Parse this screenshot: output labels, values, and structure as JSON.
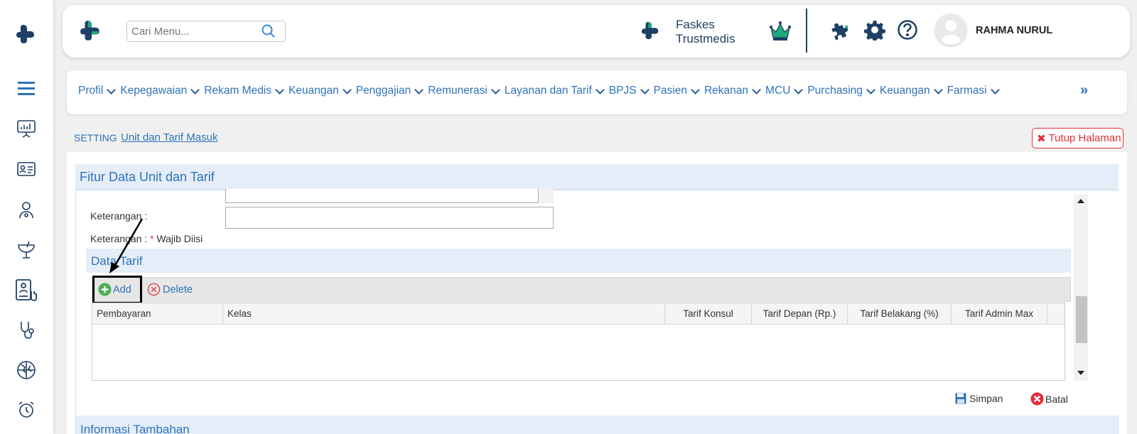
{
  "header": {
    "search_placeholder": "Cari Menu...",
    "facility_line1": "Faskes",
    "facility_line2": "Trustmedis",
    "user_name": "RAHMA NURUL"
  },
  "menu": {
    "items": [
      "Profil",
      "Kepegawaian",
      "Rekam Medis",
      "Keuangan",
      "Penggajian",
      "Remunerasi",
      "Layanan dan Tarif",
      "BPJS",
      "Pasien",
      "Rekanan",
      "MCU",
      "Purchasing",
      "Keuangan",
      "Farmasi"
    ],
    "more": "»"
  },
  "breadcrumb": {
    "root": "SETTING",
    "current": "Unit dan Tarif Masuk"
  },
  "close_label": "Tutup Halaman",
  "panel": {
    "title": "Fitur Data Unit dan Tarif",
    "keterangan_label": "Keterangan :",
    "note_prefix": "Keterangan : ",
    "note_star": "*",
    "note_text": " Wajib Diisi",
    "section_title": "Data Tarif",
    "add_label": "Add",
    "delete_label": "Delete",
    "columns": [
      "Pembayaran",
      "Kelas",
      "Tarif Konsul",
      "Tarif Depan (Rp.)",
      "Tarif Belakang (%)",
      "Tarif Admin Max"
    ],
    "save_label": "Simpan",
    "cancel_label": "Batal",
    "next_section_partial": "Informasi Tambahan"
  },
  "colors": {
    "brand_blue": "#1e3f66",
    "brand_green": "#22a87a",
    "link_blue": "#2e73b8",
    "danger": "#e0303a"
  }
}
